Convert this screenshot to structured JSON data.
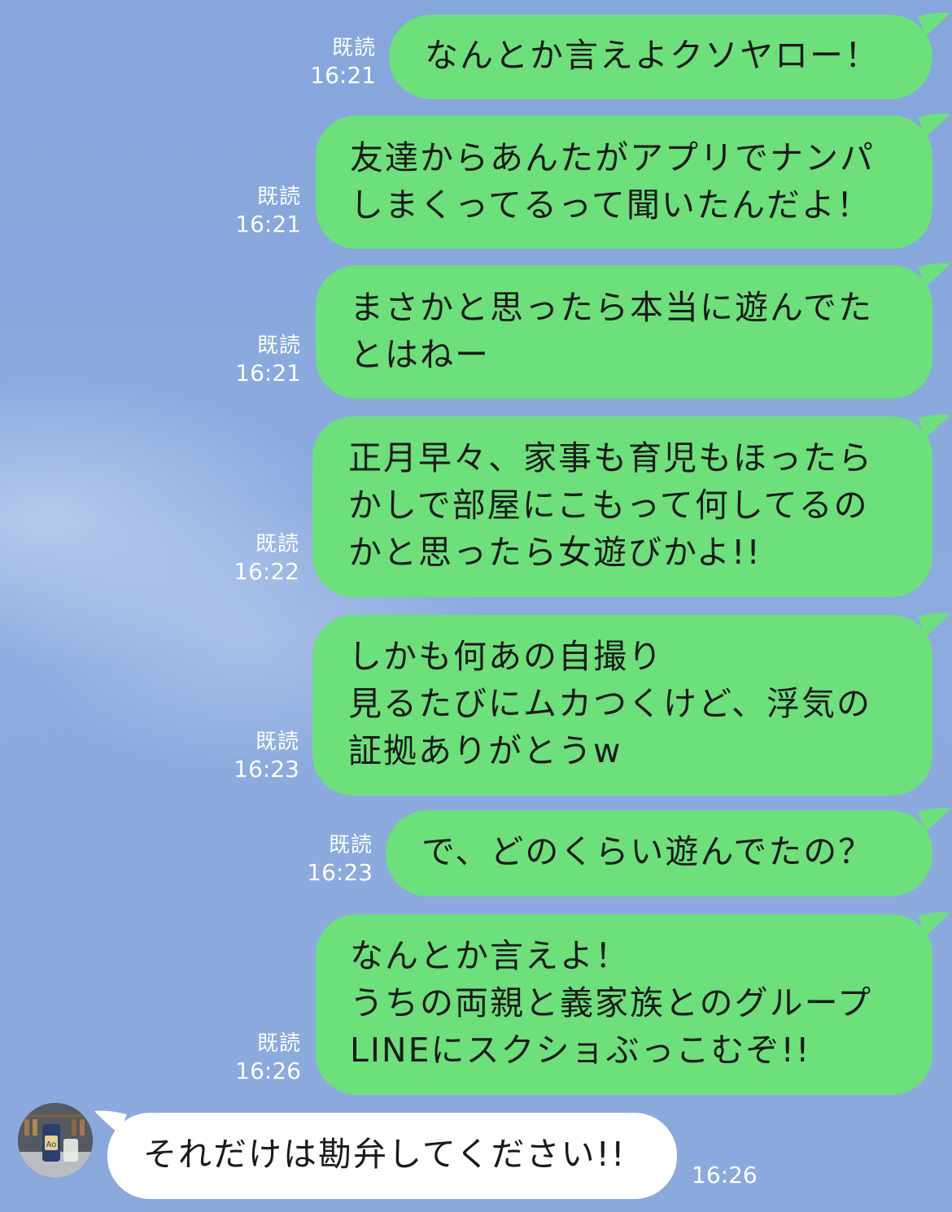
{
  "messages": [
    {
      "direction": "out",
      "read": "既読",
      "time": "16:21",
      "text": "なんとか言えよクソヤロー！"
    },
    {
      "direction": "out",
      "read": "既読",
      "time": "16:21",
      "text": "友達からあんたがアプリでナンパ\nしまくってるって聞いたんだよ！"
    },
    {
      "direction": "out",
      "read": "既読",
      "time": "16:21",
      "text": "まさかと思ったら本当に遊んでた\nとはねー"
    },
    {
      "direction": "out",
      "read": "既読",
      "time": "16:22",
      "text": "正月早々、家事も育児もほったら\nかしで部屋にこもって何してるの\nかと思ったら女遊びかよ!!"
    },
    {
      "direction": "out",
      "read": "既読",
      "time": "16:23",
      "text": "しかも何あの自撮り\n見るたびにムカつくけど、浮気の\n証拠ありがとうw"
    },
    {
      "direction": "out",
      "read": "既読",
      "time": "16:23",
      "text": "で、どのくらい遊んでたの？"
    },
    {
      "direction": "out",
      "read": "既読",
      "time": "16:26",
      "text": "なんとか言えよ！\nうちの両親と義家族とのグループ\nLINEにスクショぶっこむぞ!!"
    },
    {
      "direction": "in",
      "time": "16:26",
      "text": "それだけは勘弁してください!!"
    }
  ],
  "colors": {
    "background": "#8aa8dc",
    "outgoing_bubble": "#6de07c",
    "incoming_bubble": "#ffffff",
    "meta_text": "#ffffff"
  }
}
